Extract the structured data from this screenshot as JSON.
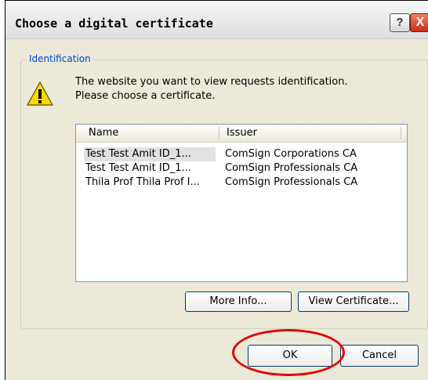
{
  "dialog": {
    "title": "Choose a digital certificate",
    "help_glyph": "?",
    "close_glyph": "X"
  },
  "group": {
    "legend": "Identification",
    "icon": "warning-icon",
    "message_line1": "The website you want to view requests identification.",
    "message_line2": "Please choose a certificate."
  },
  "list": {
    "columns": [
      "Name",
      "Issuer"
    ],
    "rows": [
      {
        "name": "Test Test Amit ID_1...",
        "issuer": "ComSign Corporations CA",
        "selected": true
      },
      {
        "name": "Test Test Amit ID_1...",
        "issuer": "ComSign Professionals CA",
        "selected": false
      },
      {
        "name": "Thila Prof Thila Prof I...",
        "issuer": "ComSign Professionals CA",
        "selected": false
      }
    ]
  },
  "buttons": {
    "more_info": "More Info...",
    "view_certificate": "View Certificate...",
    "ok": "OK",
    "cancel": "Cancel"
  },
  "colors": {
    "highlight_circle": "#e00000",
    "legend_text": "#0046d5",
    "dialog_bg": "#ece9d8"
  }
}
